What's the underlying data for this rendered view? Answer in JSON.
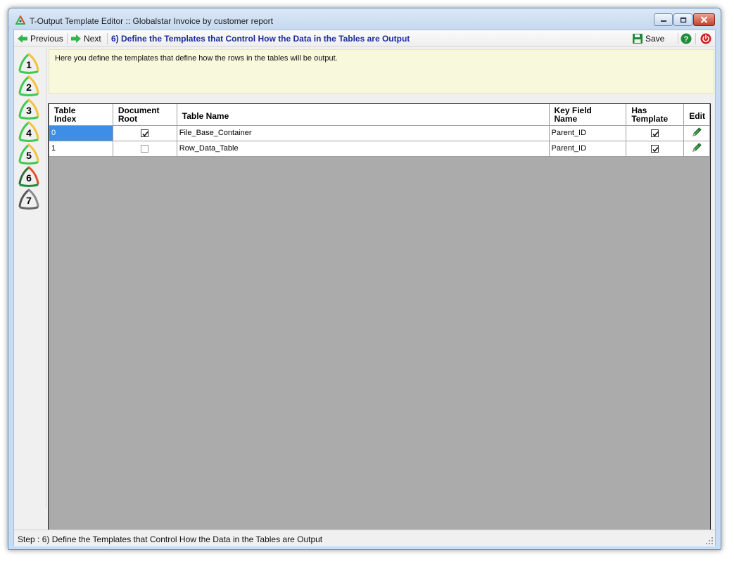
{
  "window": {
    "title": "T-Output Template Editor :: Globalstar Invoice by customer report",
    "controls": [
      "minimize",
      "maximize",
      "close"
    ]
  },
  "toolbar": {
    "previous_label": "Previous",
    "next_label": "Next",
    "step_title": "6) Define the Templates that Control How the Data in the Tables are Output",
    "save_label": "Save",
    "icons": {
      "previous": "arrow-left-icon",
      "next": "arrow-right-icon",
      "save": "floppy-disk-icon",
      "help": "help-icon",
      "power": "power-icon"
    },
    "colors": {
      "arrow": "#2fb44a",
      "step_title": "#1a2a9c",
      "save": "#1b8a3c",
      "help": "#1f8c3a",
      "power": "#d32020"
    }
  },
  "steps": [
    {
      "label": "1",
      "state": "done"
    },
    {
      "label": "2",
      "state": "done"
    },
    {
      "label": "3",
      "state": "done"
    },
    {
      "label": "4",
      "state": "done"
    },
    {
      "label": "5",
      "state": "done"
    },
    {
      "label": "6",
      "state": "current"
    },
    {
      "label": "7",
      "state": "pending"
    }
  ],
  "description": "Here you define the templates that define how the rows in the tables will be output.",
  "table": {
    "columns": [
      {
        "line1": "Table",
        "line2": "Index"
      },
      {
        "line1": "Document",
        "line2": "Root"
      },
      {
        "line1": "Table Name",
        "line2": ""
      },
      {
        "line1": "Key Field",
        "line2": "Name"
      },
      {
        "line1": "Has",
        "line2": "Template"
      },
      {
        "line1": "Edit",
        "line2": ""
      }
    ],
    "rows": [
      {
        "index": "0",
        "document_root": true,
        "table_name": "File_Base_Container",
        "key_field": "Parent_ID",
        "has_template": true,
        "edit_icon": "pencil-icon"
      },
      {
        "index": "1",
        "document_root": false,
        "table_name": "Row_Data_Table",
        "key_field": "Parent_ID",
        "has_template": true,
        "edit_icon": "pencil-icon"
      }
    ],
    "selected_color": "#3d8ee6",
    "background_color": "#ababab"
  },
  "status": {
    "text": "Step : 6) Define the Templates that Control How the Data in the Tables are Output"
  }
}
